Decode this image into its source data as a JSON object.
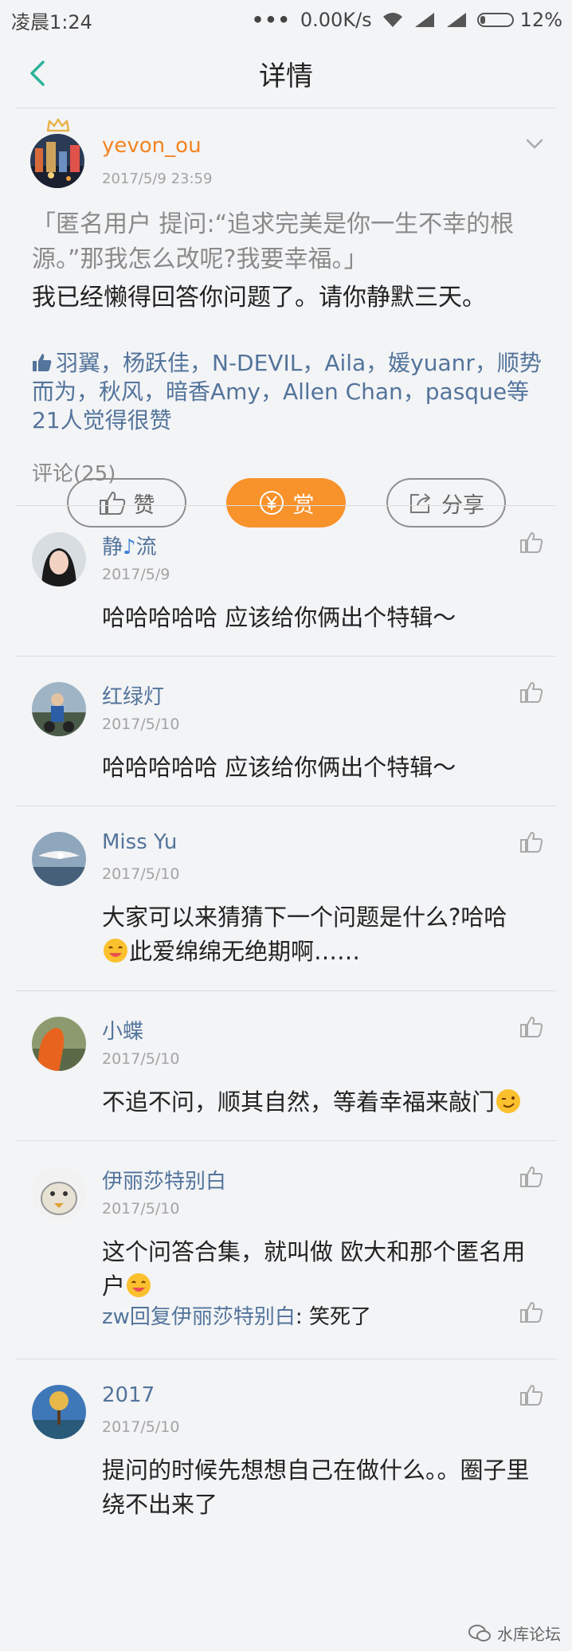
{
  "status_bar": {
    "time": "凌晨1:24",
    "net_speed": "0.00K/s",
    "battery": "12%"
  },
  "nav": {
    "title": "详情"
  },
  "post": {
    "username": "yevon_ou",
    "time": "2017/5/9 23:59",
    "question": "「匿名用户 提问:“追求完美是你一生不幸的根源。”那我怎么改呢?我要幸福。」",
    "answer": "我已经懒得回答你问题了。请你静默三天。",
    "likes_text": "羽翼，杨跃佳，N-DEVIL，Aila，媛yuanr，顺势而为，秋风，暗香Amy，Allen Chan，pasque等21人觉得很赞"
  },
  "actions": {
    "like_label": "赞",
    "reward_label": "赏",
    "share_label": "分享"
  },
  "comments_header": "评论(25)",
  "comments": [
    {
      "name": "静",
      "name_suffix": "流",
      "date": "2017/5/9",
      "text": "哈哈哈哈哈  应该给你俩出个特辑～"
    },
    {
      "name": "红绿灯",
      "date": "2017/5/10",
      "text": "哈哈哈哈哈  应该给你俩出个特辑～"
    },
    {
      "name": "Miss Yu",
      "date": "2017/5/10",
      "text_a": "大家可以来猜猜下一个问题是什么?哈哈",
      "text_b": "此爱绵绵无绝期啊……"
    },
    {
      "name": "小蝶",
      "date": "2017/5/10",
      "text": "不追不问，顺其自然，等着幸福来敲门"
    },
    {
      "name": "伊丽莎特别白",
      "date": "2017/5/10",
      "text": "这个问答合集，就叫做 欧大和那个匿名用户",
      "reply_name": "zw回复伊丽莎特别白",
      "reply_text": ": 笑死了"
    },
    {
      "name": "2017",
      "date": "2017/5/10",
      "text": "提问的时候先想想自己在做什么。。圈子里绕不出来了"
    }
  ],
  "watermark": "水库论坛",
  "colors": {
    "accent": "#f28422",
    "link": "#53749b",
    "reward": "#f8922b"
  }
}
